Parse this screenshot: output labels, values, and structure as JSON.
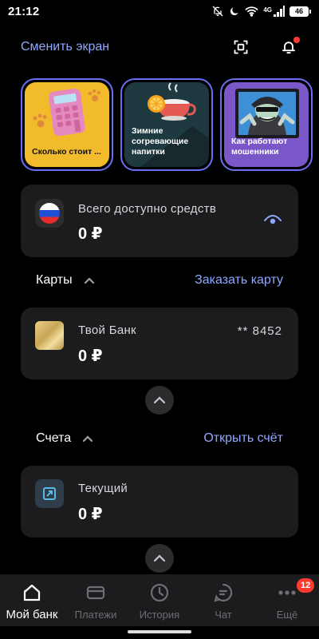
{
  "status_bar": {
    "time": "21:12",
    "network": "4G",
    "battery": "46"
  },
  "header": {
    "switch_screen": "Сменить экран"
  },
  "stories": [
    {
      "label": "Сколько стоит ...",
      "bg": "#f2bb2b"
    },
    {
      "label": "Зимние согревающие напитки",
      "bg": "#1e3a40"
    },
    {
      "label": "Как работают мошенники",
      "bg": "#7a57c9"
    }
  ],
  "available": {
    "label": "Всего доступно средств",
    "amount": "0 ₽"
  },
  "cards_section": {
    "title": "Карты",
    "action": "Заказать карту",
    "card": {
      "name": "Твой Банк",
      "number": "** 8452",
      "amount": "0 ₽"
    }
  },
  "accounts_section": {
    "title": "Счета",
    "action": "Открыть счёт",
    "account": {
      "name": "Текущий",
      "amount": "0 ₽"
    }
  },
  "nav": {
    "items": [
      {
        "label": "Мой банк",
        "icon": "home-icon"
      },
      {
        "label": "Платежи",
        "icon": "card-icon"
      },
      {
        "label": "История",
        "icon": "clock-icon"
      },
      {
        "label": "Чат",
        "icon": "chat-icon"
      },
      {
        "label": "Ещё",
        "icon": "more-icon"
      }
    ],
    "more_badge": "12"
  },
  "colors": {
    "accent": "#8fa8ff",
    "surface": "#1c1c1e",
    "story_border": "#6b6ef0",
    "badge": "#ff3b30"
  }
}
